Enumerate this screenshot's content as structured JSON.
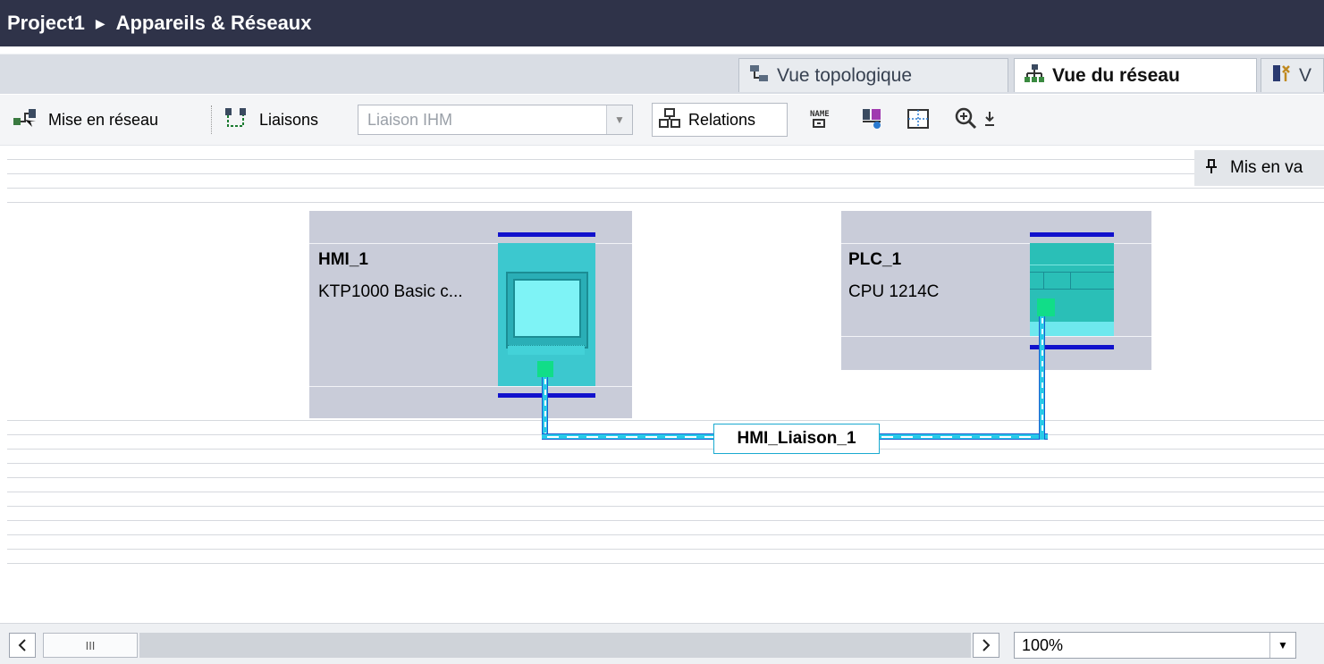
{
  "breadcrumb": {
    "project": "Project1",
    "separator_icon": "triangle-right-icon",
    "page": "Appareils & Réseaux"
  },
  "tabs": [
    {
      "label": "Vue topologique",
      "icon": "topology-icon",
      "active": false
    },
    {
      "label": "Vue du réseau",
      "icon": "network-icon",
      "active": true
    },
    {
      "label": "V",
      "icon": "device-view-icon",
      "active": false
    }
  ],
  "toolbar": {
    "networking_label": "Mise en réseau",
    "connections_label": "Liaisons",
    "connection_type_value": "Liaison IHM",
    "relations_label": "Relations",
    "icon_names": [
      "name-icon",
      "device-display-icon",
      "grid-icon",
      "zoom-in-icon",
      "download-icon"
    ]
  },
  "pinned_panel": {
    "label": "Mis en va",
    "icon": "pin-icon"
  },
  "devices": [
    {
      "name": "HMI_1",
      "type": "KTP1000 Basic c..."
    },
    {
      "name": "PLC_1",
      "type": "CPU 1214C"
    }
  ],
  "connection": {
    "label": "HMI_Liaison_1"
  },
  "statusbar": {
    "zoom_value": "100%",
    "scroll_thumb_glyph": "III"
  },
  "colors": {
    "title_bar": "#2f3349",
    "bus": "#1111cc",
    "cable": "#28c9e8",
    "port": "#11dd88",
    "device_box": "#c9ccd9"
  }
}
